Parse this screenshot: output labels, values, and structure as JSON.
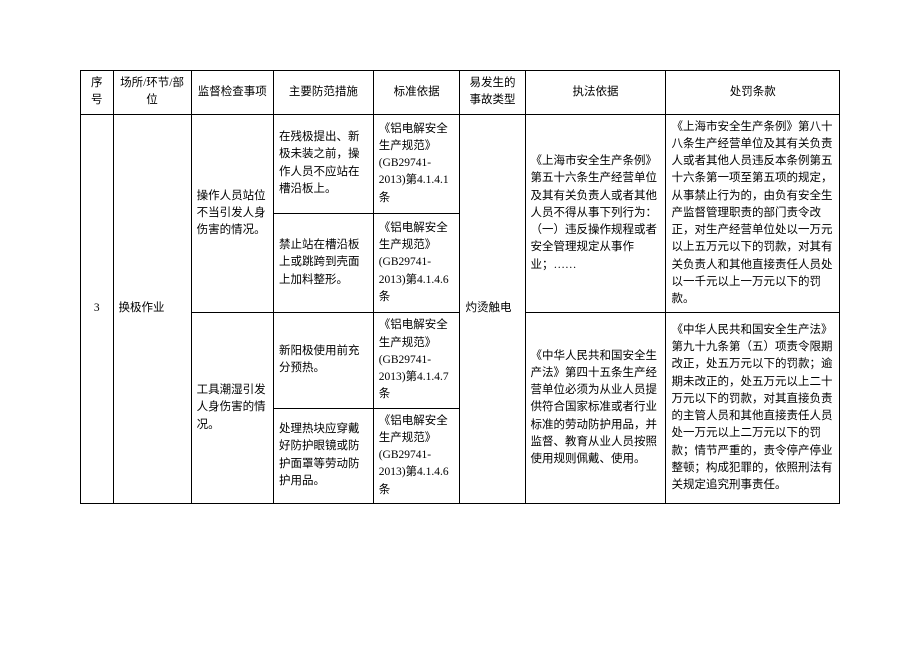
{
  "headers": {
    "seq": "序号",
    "place": "场所/环节/部位",
    "check_item": "监督检查事项",
    "measures": "主要防范措施",
    "basis": "标准依据",
    "accident": "易发生的事故类型",
    "law": "执法依据",
    "penalty": "处罚条款"
  },
  "row": {
    "seq": "3",
    "place": "换极作业",
    "check": {
      "improper_stand": "操作人员站位不当引发人身伤害的情况。",
      "tool_wet": "工具潮湿引发人身伤害的情况。"
    },
    "measures": {
      "m1": "在残极提出、新极未装之前，操作人员不应站在槽沿板上。",
      "m2": "禁止站在槽沿板上或跳跨到壳面上加料整形。",
      "m3": "新阳极使用前充分预热。",
      "m4": "处理热块应穿戴好防护眼镜或防护面罩等劳动防护用品。"
    },
    "basis": {
      "b1": "《铝电解安全生产规范》(GB29741-2013)第4.1.4.1条",
      "b2": "《铝电解安全生产规范》(GB29741-2013)第4.1.4.6条",
      "b3": "《铝电解安全生产规范》(GB29741-2013)第4.1.4.7条",
      "b4": "《铝电解安全生产规范》(GB29741-2013)第4.1.4.6条"
    },
    "accident": "灼烫触电",
    "law": {
      "l1": "《上海市安全生产条例》第五十六条生产经营单位及其有关负责人或者其他人员不得从事下列行为：（一）违反操作规程或者安全管理规定从事作业；……",
      "l2": "《中华人民共和国安全生产法》第四十五条生产经营单位必须为从业人员提供符合国家标准或者行业标准的劳动防护用品，并监督、教育从业人员按照使用规则佩戴、使用。"
    },
    "penalty": {
      "p1": "《上海市安全生产条例》第八十八条生产经营单位及其有关负责人或者其他人员违反本条例第五十六条第一项至第五项的规定，从事禁止行为的，由负有安全生产监督管理职责的部门责令改正，对生产经营单位处以一万元以上五万元以下的罚款，对其有关负责人和其他直接责任人员处以一千元以上一万元以下的罚款。",
      "p2": "《中华人民共和国安全生产法》第九十九条第（五）项责令限期改正，处五万元以下的罚款；逾期未改正的，处五万元以上二十万元以下的罚款，对其直接负责的主管人员和其他直接责任人员处一万元以上二万元以下的罚款；情节严重的，责令停产停业整顿；构成犯罪的，依照刑法有关规定追究刑事责任。"
    }
  }
}
